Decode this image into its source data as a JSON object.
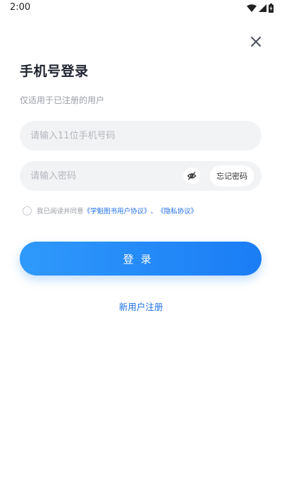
{
  "status_bar": {
    "time": "2:00",
    "icons": [
      "wifi-icon",
      "signal-icon",
      "battery-charging-icon"
    ]
  },
  "login": {
    "title": "手机号登录",
    "subtitle": "仅适用于已注册的用户",
    "phone_placeholder": "请输入11位手机号码",
    "password_placeholder": "请输入密码",
    "forgot_label": "忘记密码",
    "agreement": {
      "prefix": "我已阅读并同意",
      "user_agreement": "《学魁图书用户协议》",
      "separator": "、",
      "privacy_policy": "《隐私协议》"
    },
    "login_button": "登录",
    "register_link": "新用户注册"
  },
  "colors": {
    "accent": "#1f6fe6",
    "button_start": "#2f99fb",
    "button_end": "#1a7df5",
    "field_bg": "#f2f3f5"
  }
}
